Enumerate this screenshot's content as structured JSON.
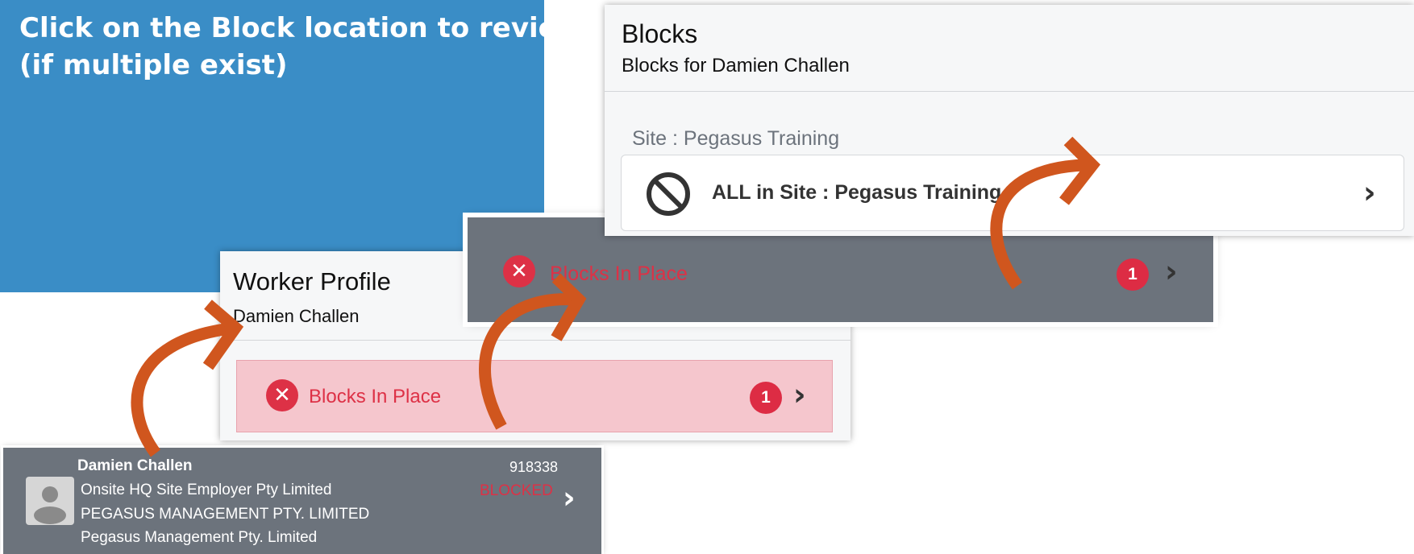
{
  "instruction": {
    "line1": "Click on the Block location to review",
    "line2": "(if multiple exist)"
  },
  "worker_profile": {
    "title": "Worker Profile",
    "subtitle": "Damien Challen",
    "blocks_row": {
      "label": "Blocks In Place",
      "count": "1",
      "icon": "x-circle-icon"
    }
  },
  "gray_strip": {
    "label": "Blocks In Place",
    "count": "1"
  },
  "blocks_panel": {
    "title": "Blocks",
    "subtitle": "Blocks for Damien Challen",
    "site_label": "Site : Pegasus Training",
    "item": {
      "label": "ALL in Site : Pegasus Training",
      "icon": "prohibited-icon"
    }
  },
  "worker_card": {
    "name": "Damien Challen",
    "id": "918338",
    "status": "BLOCKED",
    "employer_1": "Onsite HQ Site Employer Pty Limited",
    "employer_2": "PEGASUS MANAGEMENT PTY. LIMITED",
    "employer_3": "Pegasus Management Pty. Limited"
  },
  "colors": {
    "banner": "#3a8dc6",
    "danger": "#dd3146",
    "pink_row": "#f5c6cd",
    "gray_card": "#6c737c",
    "arrow": "#d0561e"
  }
}
